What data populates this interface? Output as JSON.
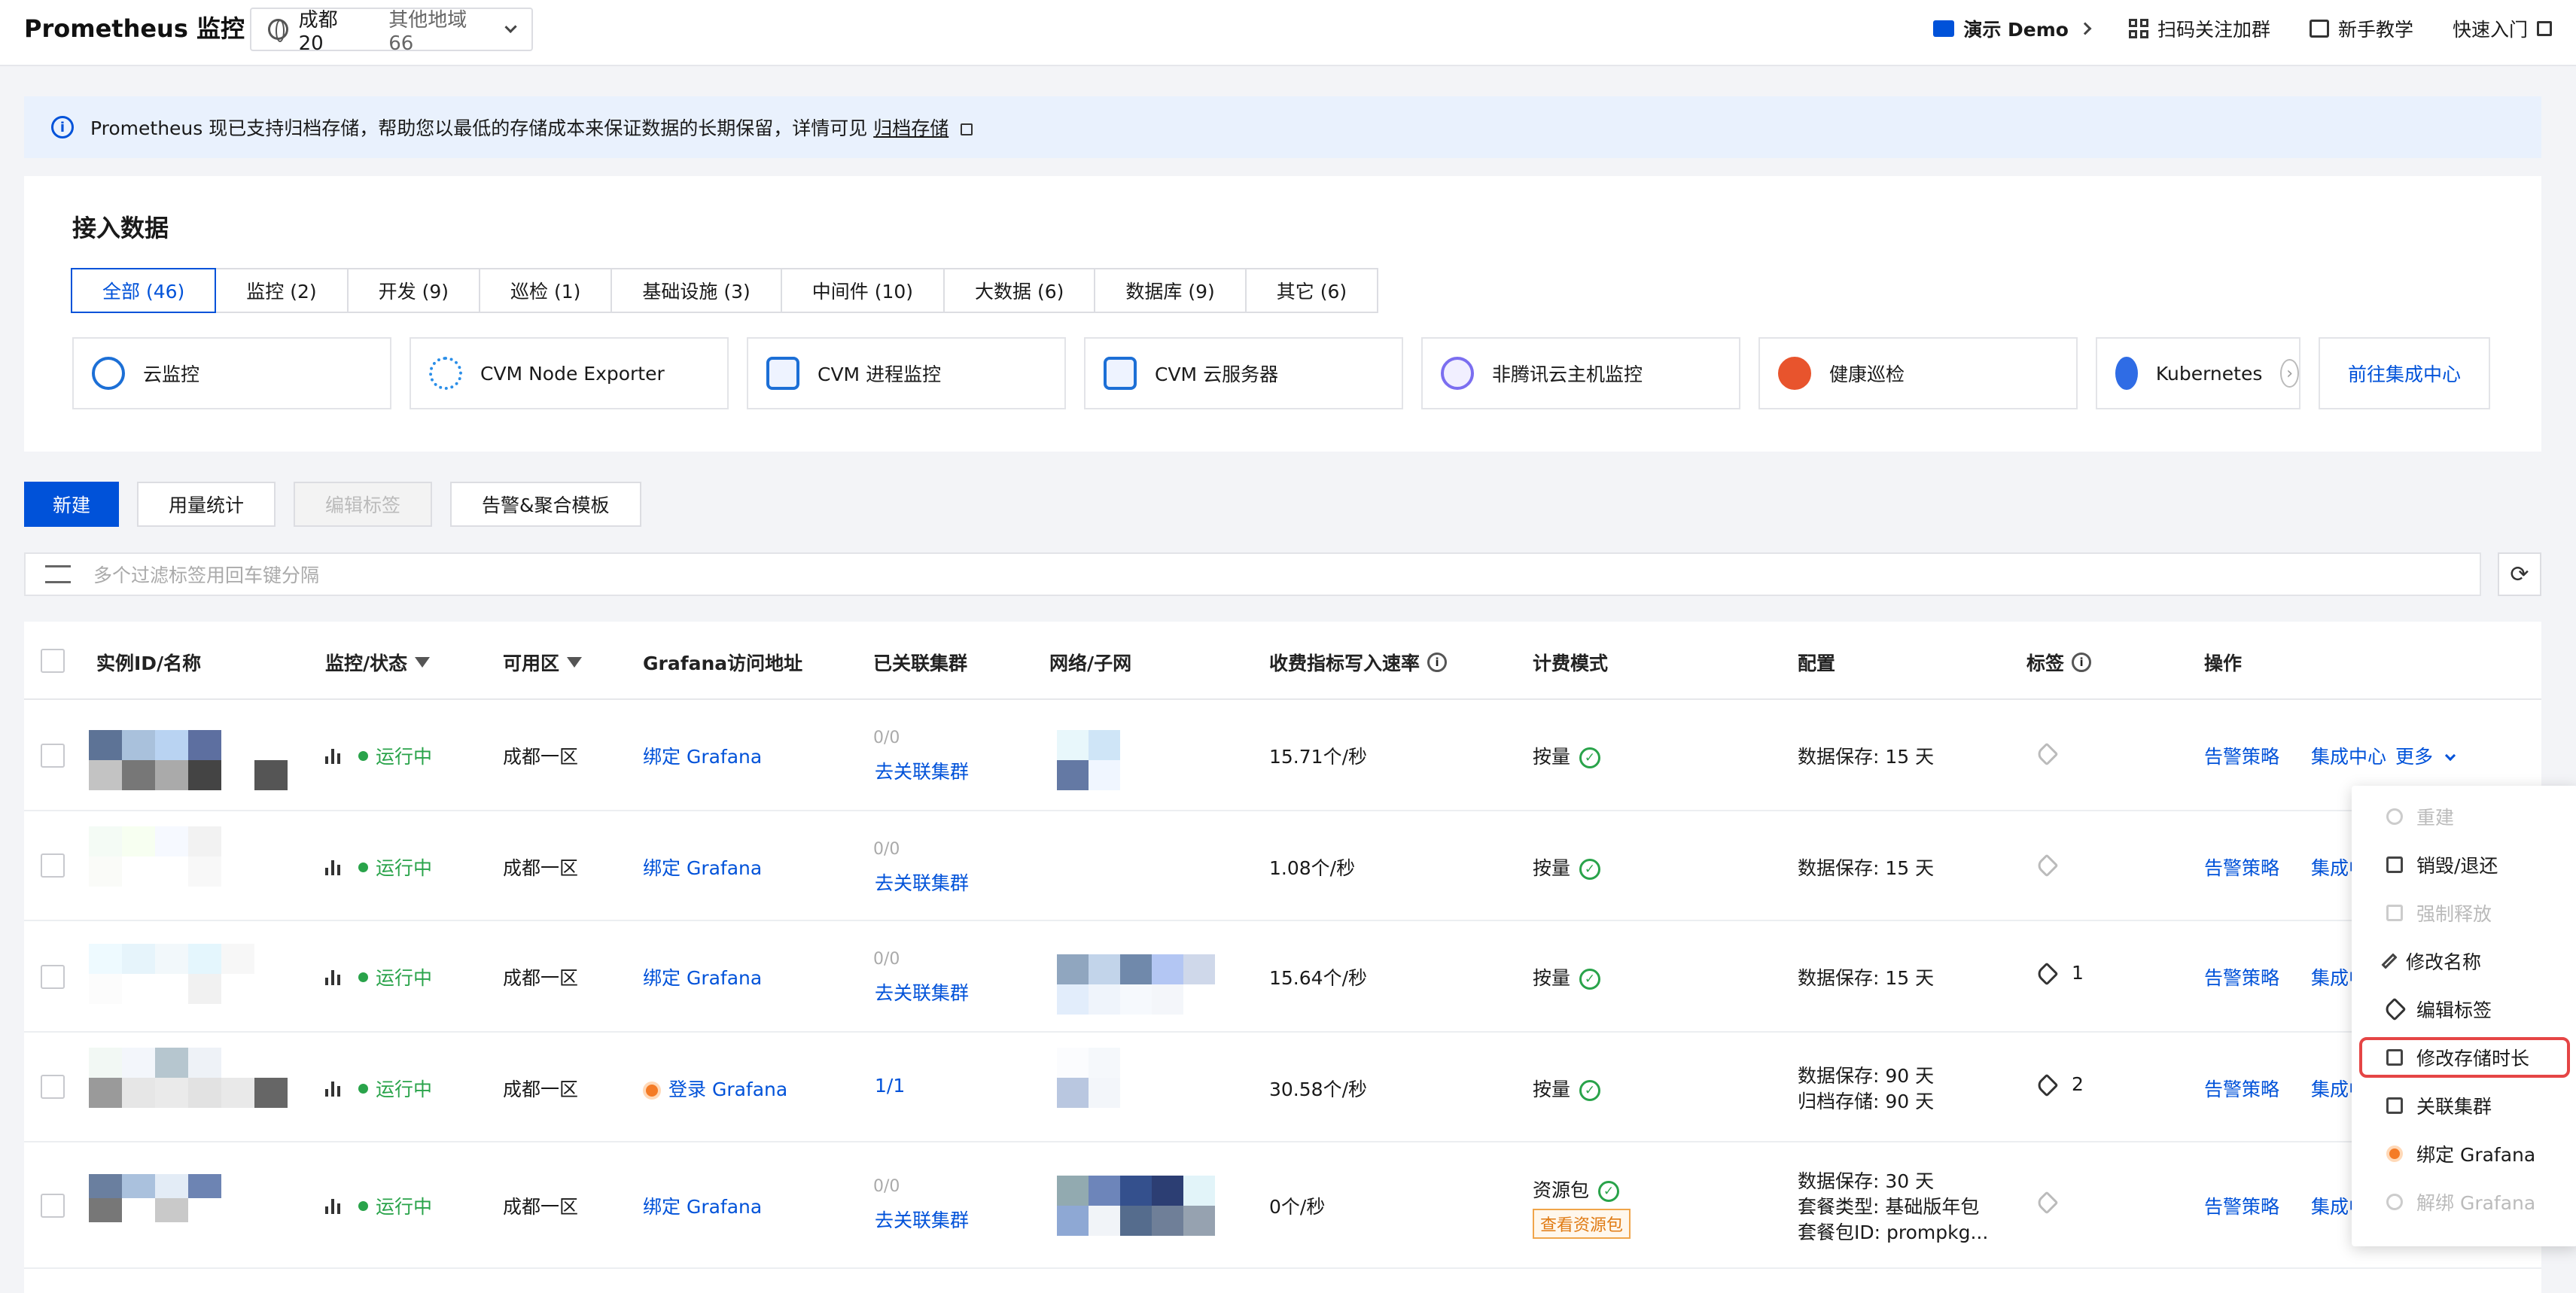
{
  "header": {
    "title": "Prometheus 监控",
    "region_current": "成都 20",
    "region_other": "其他地域 66",
    "links": [
      "演示 Demo",
      "扫码关注加群",
      "新手教学",
      "快速入门"
    ]
  },
  "notice": {
    "text": "Prometheus 现已支持归档存储，帮助您以最低的存储成本来保证数据的长期保留，详情可见",
    "link": "归档存储"
  },
  "integration": {
    "title": "接入数据",
    "tabs": [
      "全部 (46)",
      "监控 (2)",
      "开发 (9)",
      "巡检 (1)",
      "基础设施 (3)",
      "中间件 (10)",
      "大数据 (6)",
      "数据库 (9)",
      "其它 (6)"
    ],
    "cards": [
      "云监控",
      "CVM Node Exporter",
      "CVM 进程监控",
      "CVM 云服务器",
      "非腾讯云主机监控",
      "健康巡检",
      "Kubernetes"
    ],
    "goto": "前往集成中心"
  },
  "toolbar": {
    "new": "新建",
    "usage": "用量统计",
    "edit_tags": "编辑标签",
    "alert_template": "告警&聚合模板"
  },
  "search": {
    "placeholder": "多个过滤标签用回车键分隔"
  },
  "table": {
    "headers": [
      "实例ID/名称",
      "监控/状态",
      "可用区",
      "Grafana访问地址",
      "已关联集群",
      "网络/子网",
      "收费指标写入速率",
      "计费模式",
      "配置",
      "标签",
      "操作"
    ],
    "rows": [
      {
        "status": "运行中",
        "zone": "成都一区",
        "grafana": "绑定 Grafana",
        "cluster_count": "0/0",
        "cluster_link": "去关联集群",
        "rate": "15.71个/秒",
        "billing": "按量",
        "config": [
          "数据保存: 15 天"
        ],
        "tags": "",
        "ops": [
          "告警策略",
          "集成中心",
          "更多"
        ]
      },
      {
        "status": "运行中",
        "zone": "成都一区",
        "grafana": "绑定 Grafana",
        "cluster_count": "0/0",
        "cluster_link": "去关联集群",
        "rate": "1.08个/秒",
        "billing": "按量",
        "config": [
          "数据保存: 15 天"
        ],
        "tags": "",
        "ops": [
          "告警策略",
          "集成中心"
        ]
      },
      {
        "status": "运行中",
        "zone": "成都一区",
        "grafana": "绑定 Grafana",
        "cluster_count": "0/0",
        "cluster_link": "去关联集群",
        "rate": "15.64个/秒",
        "billing": "按量",
        "config": [
          "数据保存: 15 天"
        ],
        "tags": "1",
        "ops": [
          "告警策略",
          "集成中心"
        ]
      },
      {
        "status": "运行中",
        "zone": "成都一区",
        "grafana": "登录 Grafana",
        "cluster_count": "1/1",
        "cluster_link": "",
        "rate": "30.58个/秒",
        "billing": "按量",
        "config": [
          "数据保存: 90 天",
          "归档存储:  90 天"
        ],
        "tags": "2",
        "ops": [
          "告警策略",
          "集成中心"
        ]
      },
      {
        "status": "运行中",
        "zone": "成都一区",
        "grafana": "绑定 Grafana",
        "cluster_count": "0/0",
        "cluster_link": "去关联集群",
        "rate": "0个/秒",
        "billing": "资源包",
        "billing_badge": "查看资源包",
        "config": [
          "数据保存: 30 天",
          "套餐类型: 基础版年包",
          "套餐包ID:  prompkg..."
        ],
        "tags": "",
        "ops": [
          "告警策略",
          "集成中心"
        ]
      }
    ]
  },
  "dropdown": {
    "items": [
      "重建",
      "销毁/退还",
      "强制释放",
      "修改名称",
      "编辑标签",
      "修改存储时长",
      "关联集群",
      "绑定 Grafana",
      "解绑 Grafana"
    ]
  }
}
